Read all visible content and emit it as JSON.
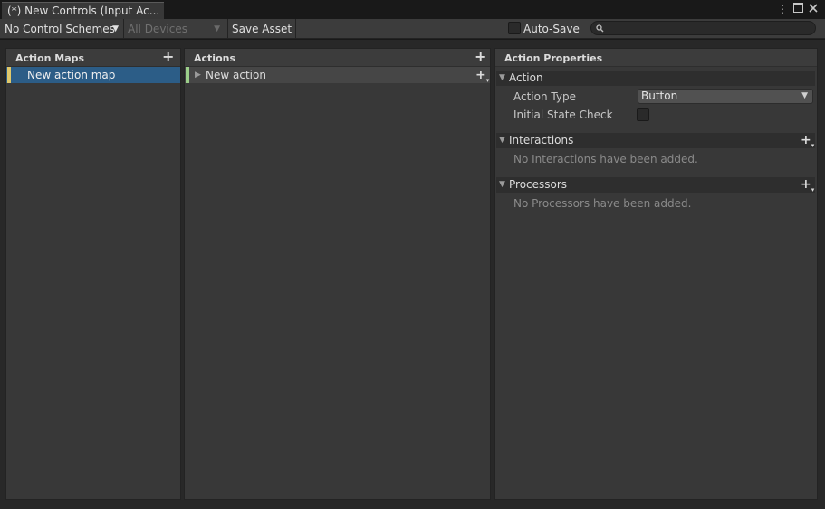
{
  "window": {
    "tab_title": "(*) New Controls (Input Ac...",
    "menu_icon": "kebab-icon",
    "maximize_icon": "maximize-icon",
    "close_icon": "close-icon"
  },
  "toolbar": {
    "control_scheme": "No Control Schemes",
    "devices": "All Devices",
    "save_label": "Save Asset",
    "auto_save_label": "Auto-Save",
    "auto_save_checked": false,
    "search_value": ""
  },
  "action_maps": {
    "title": "Action Maps",
    "add_icon": "plus-icon",
    "items": [
      {
        "label": "New action map",
        "selected": true,
        "marker_color": "#e0c86a"
      }
    ]
  },
  "actions": {
    "title": "Actions",
    "add_icon": "plus-icon",
    "items": [
      {
        "label": "New action",
        "marker_color": "#9ccf8a"
      }
    ]
  },
  "properties": {
    "title": "Action Properties",
    "action_section": {
      "title": "Action",
      "action_type_label": "Action Type",
      "action_type_value": "Button",
      "initial_state_label": "Initial State Check",
      "initial_state_checked": false
    },
    "interactions": {
      "title": "Interactions",
      "empty_text": "No Interactions have been added."
    },
    "processors": {
      "title": "Processors",
      "empty_text": "No Processors have been added."
    }
  },
  "colors": {
    "selection": "#2c5d87",
    "panel": "#383838",
    "background": "#282828"
  }
}
